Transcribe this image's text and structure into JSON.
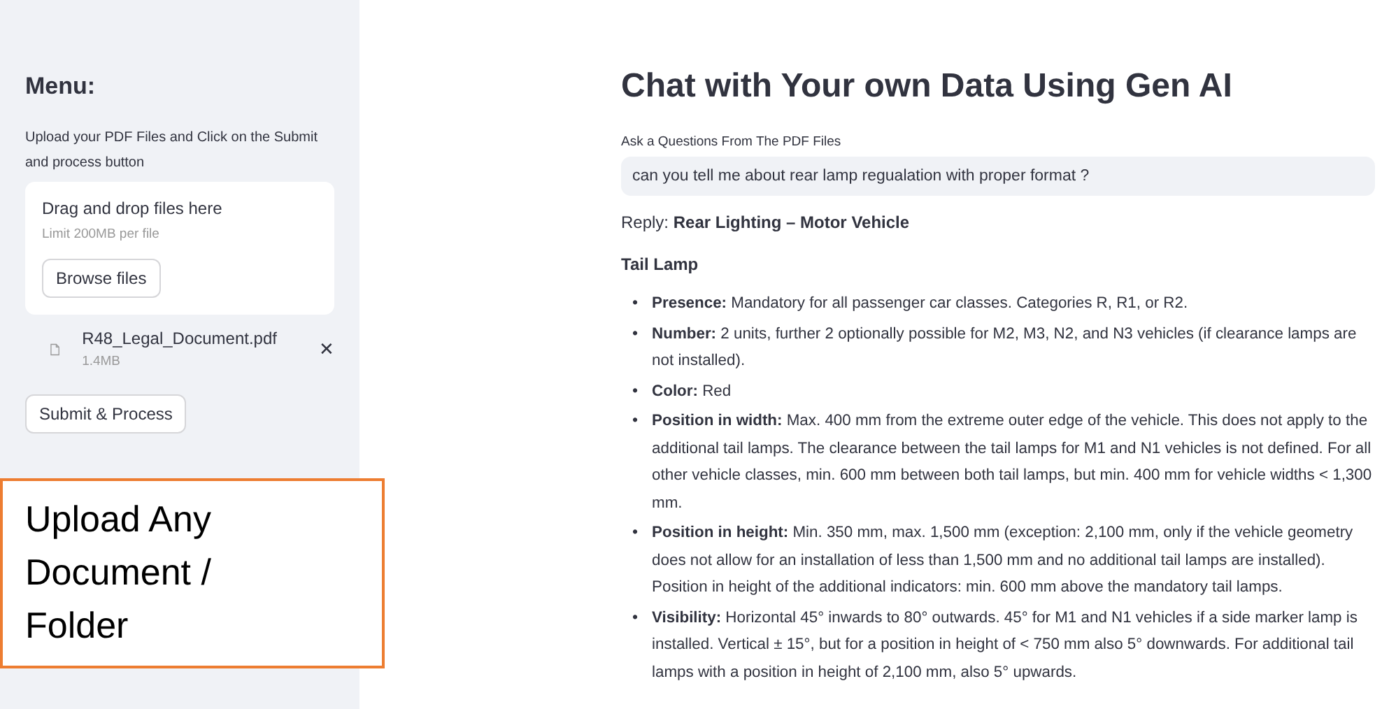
{
  "sidebar": {
    "title": "Menu:",
    "instructions": "Upload your PDF Files and Click on the Submit and process button",
    "dropzone": {
      "label": "Drag and drop files here",
      "limit": "Limit 200MB per file",
      "button": "Browse files"
    },
    "files": [
      {
        "name": "R48_Legal_Document.pdf",
        "size": "1.4MB",
        "remove": "✕"
      }
    ],
    "submit_button": "Submit & Process"
  },
  "callout": {
    "text": "Upload Any Document / Folder"
  },
  "main": {
    "title": "Chat with Your own Data Using Gen AI",
    "question_label": "Ask a Questions From The PDF Files",
    "question_value": "can you tell me about rear lamp regualation with proper format ?",
    "reply": "Reply: **Rear Lighting – Motor Vehicle**",
    "section": "Tail Lamp",
    "bullets": [
      {
        "marker": "•",
        "text": "**Presence:** Mandatory for all passenger car classes. Categories R, R1, or R2."
      },
      {
        "marker": "•",
        "text": "**Number:** 2 units, further 2 optionally possible for M2, M3, N2, and N3 vehicles (if clearance lamps are not installed)."
      },
      {
        "marker": "•",
        "text": "**Color:** Red"
      },
      {
        "marker": "•",
        "text": "**Position in width:** Max. 400 mm from the extreme outer edge of the vehicle. This does not apply to the additional tail lamps. The clearance between the tail lamps for M1 and N1 vehicles is not defined. For all other vehicle classes, min. 600 mm between both tail lamps, but min. 400 mm for vehicle widths < 1,300 mm."
      },
      {
        "marker": "•",
        "text": "**Position in height:** Min. 350 mm, max. 1,500 mm (exception: 2,100 mm, only if the vehicle geometry does not allow for an installation of less than 1,500 mm and no additional tail lamps are installed). Position in height of the additional indicators: min. 600 mm above the mandatory tail lamps."
      },
      {
        "marker": "•",
        "text": "**Visibility:** Horizontal 45° inwards to 80° outwards. 45° for M1 and N1 vehicles if a side marker lamp is installed. Vertical ± 15°, but for a position in height of < 750 mm also 5° downwards. For additional tail lamps with a position in height of 2,100 mm, also 5° upwards."
      }
    ]
  }
}
